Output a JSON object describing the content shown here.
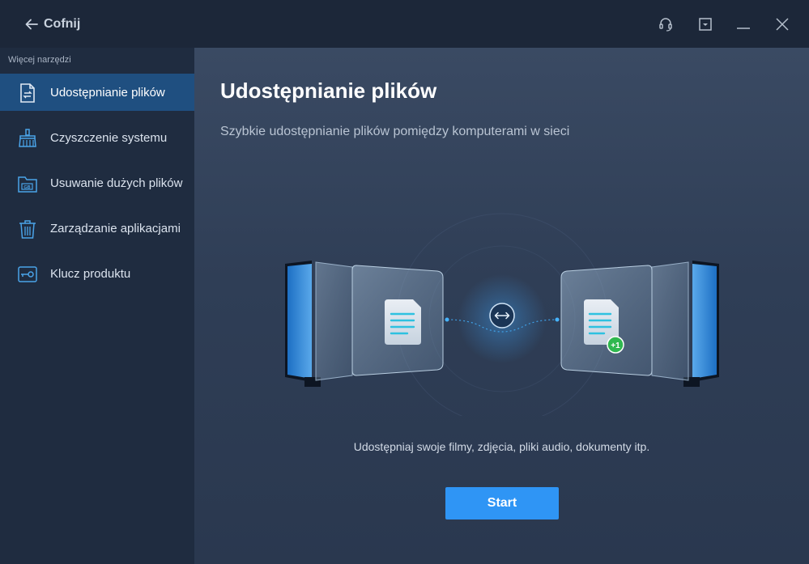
{
  "titlebar": {
    "back_label": "Cofnij",
    "icons": [
      "headset-icon",
      "dropdown-menu-icon",
      "minimize-icon",
      "close-icon"
    ]
  },
  "sidebar": {
    "section_label": "Więcej narzędzi",
    "items": [
      {
        "label": "Udostępnianie plików",
        "icon": "file-transfer-icon",
        "active": true
      },
      {
        "label": "Czyszczenie systemu",
        "icon": "broom-icon",
        "active": false
      },
      {
        "label": "Usuwanie dużych plików",
        "icon": "gb-folder-icon",
        "active": false
      },
      {
        "label": "Zarządzanie aplikacjami",
        "icon": "trash-icon",
        "active": false
      },
      {
        "label": "Klucz produktu",
        "icon": "key-icon",
        "active": false
      }
    ]
  },
  "main": {
    "title": "Udostępnianie plików",
    "subtitle": "Szybkie udostępnianie plików pomiędzy komputerami w sieci",
    "badge": "+1",
    "caption": "Udostępniaj swoje filmy, zdjęcia, pliki audio, dokumenty itp.",
    "start_label": "Start"
  },
  "colors": {
    "titlebar_bg": "#1c2739",
    "sidebar_bg": "#1f2c40",
    "active_item_bg": "#1f4f80",
    "accent_blue": "#2f95f5",
    "badge_green": "#2fb84f",
    "icon_blue": "#4aa3e8"
  }
}
